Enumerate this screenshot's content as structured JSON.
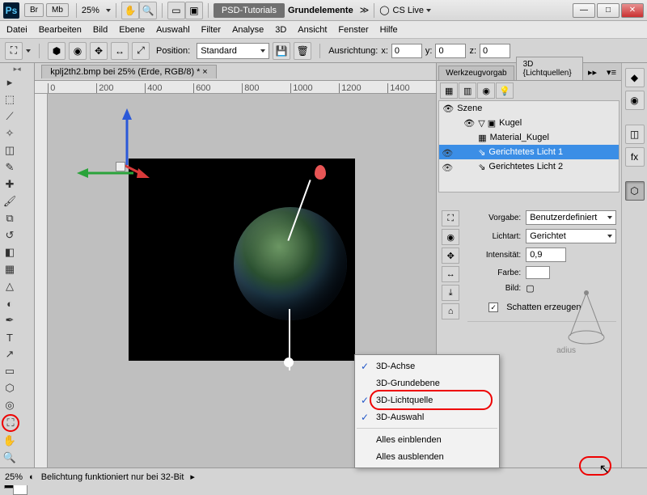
{
  "titlebar": {
    "br": "Br",
    "mb": "Mb",
    "zoom": "25%",
    "dark1": "PSD-Tutorials",
    "dark2": "Grundelemente",
    "cslive": "CS Live"
  },
  "menu": {
    "items": [
      "Datei",
      "Bearbeiten",
      "Bild",
      "Ebene",
      "Auswahl",
      "Filter",
      "Analyse",
      "3D",
      "Ansicht",
      "Fenster",
      "Hilfe"
    ]
  },
  "optbar": {
    "position_label": "Position:",
    "position_value": "Standard",
    "ausrichtung": "Ausrichtung:",
    "x_label": "x:",
    "x_val": "0",
    "y_label": "y:",
    "y_val": "0",
    "z_label": "z:",
    "z_val": "0"
  },
  "doc": {
    "tab": "kplj2th2.bmp bei 25% (Erde, RGB/8) *",
    "ruler_marks": [
      "0",
      "200",
      "400",
      "600",
      "800",
      "1000",
      "1200",
      "1400"
    ]
  },
  "panel": {
    "tab1": "Werkzeugvorgab",
    "tab2": "3D {Lichtquellen}",
    "scene": {
      "root": "Szene",
      "obj": "Kugel",
      "mat": "Material_Kugel",
      "light1": "Gerichtetes Licht 1",
      "light2": "Gerichtetes Licht 2"
    },
    "props": {
      "vorgabe_label": "Vorgabe:",
      "vorgabe_val": "Benutzerdefiniert",
      "lichtart_label": "Lichtart:",
      "lichtart_val": "Gerichtet",
      "intensitaet_label": "Intensität:",
      "intensitaet_val": "0,9",
      "farbe_label": "Farbe:",
      "bild_label": "Bild:",
      "schatten": "Schatten erzeugen",
      "radius": "adius"
    }
  },
  "context": {
    "items": [
      "3D-Achse",
      "3D-Grundebene",
      "3D-Lichtquelle",
      "3D-Auswahl"
    ],
    "all_show": "Alles einblenden",
    "all_hide": "Alles ausblenden"
  },
  "status": {
    "zoom": "25%",
    "msg": "Belichtung funktioniert nur bei 32-Bit"
  }
}
